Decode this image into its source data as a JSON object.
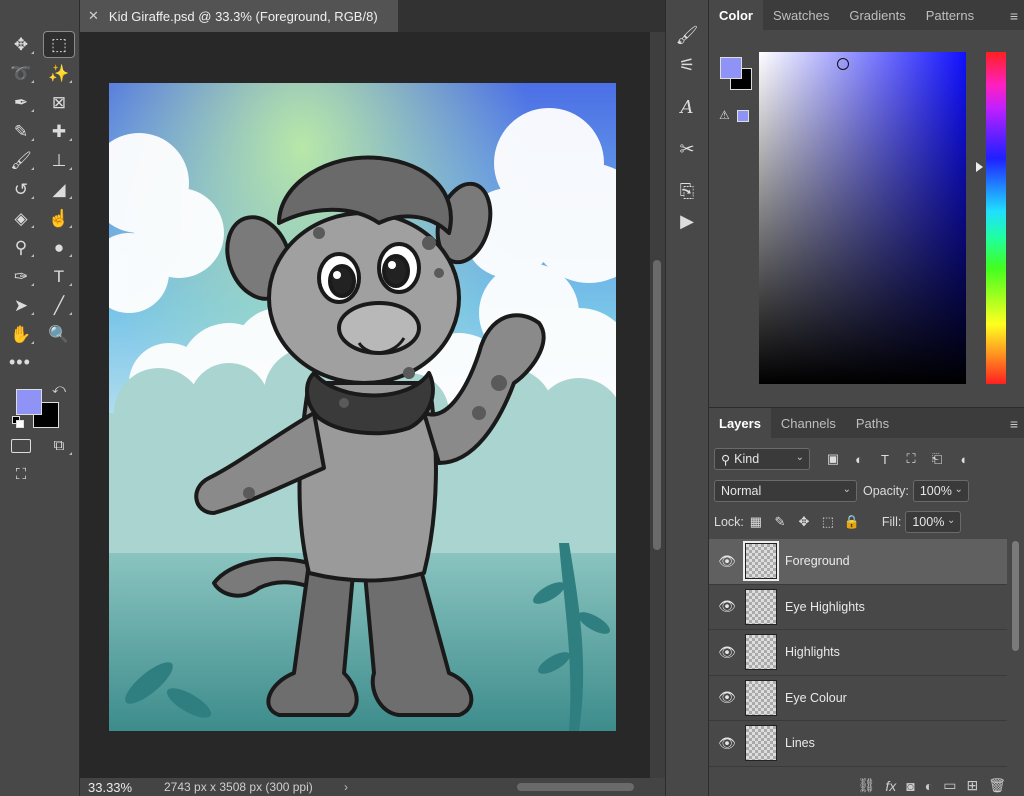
{
  "document": {
    "tab_title": "Kid Giraffe.psd @ 33.3% (Foreground, RGB/8)",
    "zoom": "33.33%",
    "doc_info": "2743 px x 3508 px (300 ppi)"
  },
  "colors": {
    "foreground": "#8f93f5",
    "background": "#000000"
  },
  "toolbar": {
    "tools": [
      {
        "icon": "move-icon",
        "glyph": "✥"
      },
      {
        "icon": "rectangular-marquee-icon",
        "glyph": "⬚"
      },
      {
        "icon": "lasso-icon",
        "glyph": "➰"
      },
      {
        "icon": "magic-wand-icon",
        "glyph": "✨"
      },
      {
        "icon": "pen-nib-icon",
        "glyph": "✒"
      },
      {
        "icon": "frame-icon",
        "glyph": "⊠"
      },
      {
        "icon": "eyedropper-icon",
        "glyph": "✎"
      },
      {
        "icon": "healing-brush-icon",
        "glyph": "✚"
      },
      {
        "icon": "brush-icon",
        "glyph": "🖌"
      },
      {
        "icon": "clone-stamp-icon",
        "glyph": "⊥"
      },
      {
        "icon": "history-brush-icon",
        "glyph": "↺"
      },
      {
        "icon": "eraser-icon",
        "glyph": "◢"
      },
      {
        "icon": "paint-bucket-icon",
        "glyph": "◈"
      },
      {
        "icon": "smudge-icon",
        "glyph": "☝"
      },
      {
        "icon": "dodge-icon",
        "glyph": "⚲"
      },
      {
        "icon": "dodge-alt-icon",
        "glyph": "●"
      },
      {
        "icon": "pen-icon",
        "glyph": "✑"
      },
      {
        "icon": "type-icon",
        "glyph": "T"
      },
      {
        "icon": "path-selection-icon",
        "glyph": "➤"
      },
      {
        "icon": "line-icon",
        "glyph": "╱"
      },
      {
        "icon": "hand-icon",
        "glyph": "✋"
      },
      {
        "icon": "zoom-icon",
        "glyph": "🔍"
      }
    ],
    "more": "•••"
  },
  "midstrip": {
    "icons": [
      {
        "icon": "brush-settings-icon",
        "glyph": "🖌"
      },
      {
        "icon": "adjustments-icon",
        "glyph": "⚟"
      },
      {
        "icon": "character-icon",
        "glyph": "A"
      },
      {
        "icon": "tools-icon",
        "glyph": "✂"
      },
      {
        "icon": "history-icon",
        "glyph": "⎘"
      },
      {
        "icon": "actions-icon",
        "glyph": "▶"
      }
    ]
  },
  "color_panel": {
    "tabs": [
      "Color",
      "Swatches",
      "Gradients",
      "Patterns"
    ]
  },
  "layers_panel": {
    "tabs": [
      "Layers",
      "Channels",
      "Paths"
    ],
    "kind_filter": "Kind",
    "blend_mode": "Normal",
    "opacity_label": "Opacity:",
    "opacity_value": "100%",
    "lock_label": "Lock:",
    "fill_label": "Fill:",
    "fill_value": "100%",
    "layers": [
      {
        "name": "Foreground",
        "selected": true
      },
      {
        "name": "Eye Highlights",
        "selected": false
      },
      {
        "name": "Highlights",
        "selected": false
      },
      {
        "name": "Eye Colour",
        "selected": false
      },
      {
        "name": "Lines",
        "selected": false
      }
    ]
  }
}
